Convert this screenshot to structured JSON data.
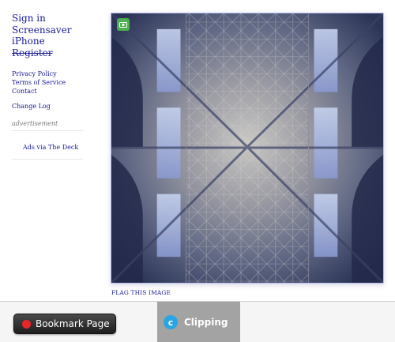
{
  "sidebar": {
    "main_links": [
      {
        "label": "Sign in"
      },
      {
        "label": "Screensaver"
      },
      {
        "label": "iPhone"
      },
      {
        "label": "Register"
      }
    ],
    "small_links": [
      {
        "label": "Privacy Policy"
      },
      {
        "label": "Terms of Service"
      },
      {
        "label": "Contact"
      }
    ],
    "changelog_label": "Change Log",
    "ad_label": "advertisement",
    "ad_link": "Ads via The Deck"
  },
  "main": {
    "flag_label": "FLAG THIS IMAGE",
    "badge_icon": "camera-icon"
  },
  "bottom_bar": {
    "bookmark_label": "Bookmark Page",
    "clipping_label": "Clipping",
    "clipping_icon_letter": "c"
  },
  "colors": {
    "link": "#1a1a99",
    "badge": "#4caf50",
    "bookmark_dot": "#e8262a",
    "clipping_bg": "#a3a3a3",
    "clipping_icon": "#2aa5e4"
  }
}
